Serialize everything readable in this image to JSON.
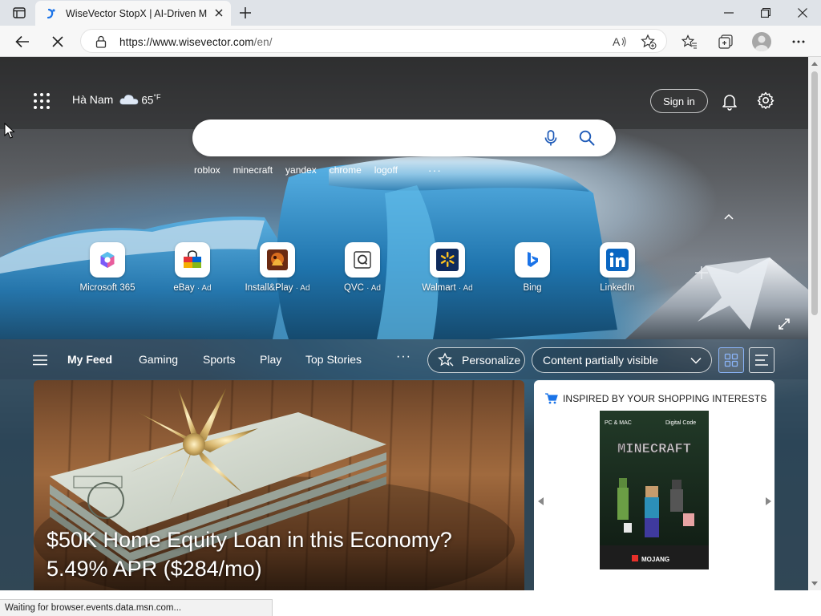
{
  "browser": {
    "tab": {
      "title": "WiseVector StopX | AI-Driven Ma"
    },
    "url": {
      "host": "https://www.wisevector.com",
      "path": "/en/"
    }
  },
  "header": {
    "weather": {
      "city": "Hà Nam",
      "temp": "65",
      "unit": "°F"
    },
    "signin_label": "Sign in"
  },
  "search": {
    "placeholder": "",
    "trending": [
      "roblox",
      "minecraft",
      "yandex",
      "chrome",
      "logoff"
    ],
    "more": "···"
  },
  "quick_links": [
    {
      "label": "Microsoft 365",
      "ad": "",
      "icon": "microsoft-365-icon"
    },
    {
      "label": "eBay",
      "ad": "· Ad",
      "icon": "ebay-icon"
    },
    {
      "label": "Install&Play",
      "ad": "· Ad",
      "icon": "install-play-icon"
    },
    {
      "label": "QVC",
      "ad": "· Ad",
      "icon": "qvc-icon"
    },
    {
      "label": "Walmart",
      "ad": "· Ad",
      "icon": "walmart-icon"
    },
    {
      "label": "Bing",
      "ad": "",
      "icon": "bing-icon"
    },
    {
      "label": "LinkedIn",
      "ad": "",
      "icon": "linkedin-icon"
    }
  ],
  "feed": {
    "tabs": [
      "My Feed",
      "Gaming",
      "Sports",
      "Play",
      "Top Stories"
    ],
    "active_tab": "My Feed",
    "more": "···",
    "personalize_label": "Personalize",
    "content_visibility": "Content partially visible"
  },
  "hero": {
    "title_line1": "$50K Home Equity Loan in this Economy?",
    "title_line2": "5.49% APR ($284/mo)"
  },
  "shopping": {
    "heading": "INSPIRED BY YOUR SHOPPING INTERESTS",
    "more": "···",
    "product": {
      "platform": "PC & MAC",
      "edition": "Digital Code",
      "title": "MINECRAFT",
      "publisher": "MOJANG"
    }
  },
  "status": {
    "text": "Waiting for browser.events.data.msn.com..."
  },
  "colors": {
    "accent": "#0a66c2",
    "bing": "#1a73e8",
    "walmart": "#0071ce"
  }
}
